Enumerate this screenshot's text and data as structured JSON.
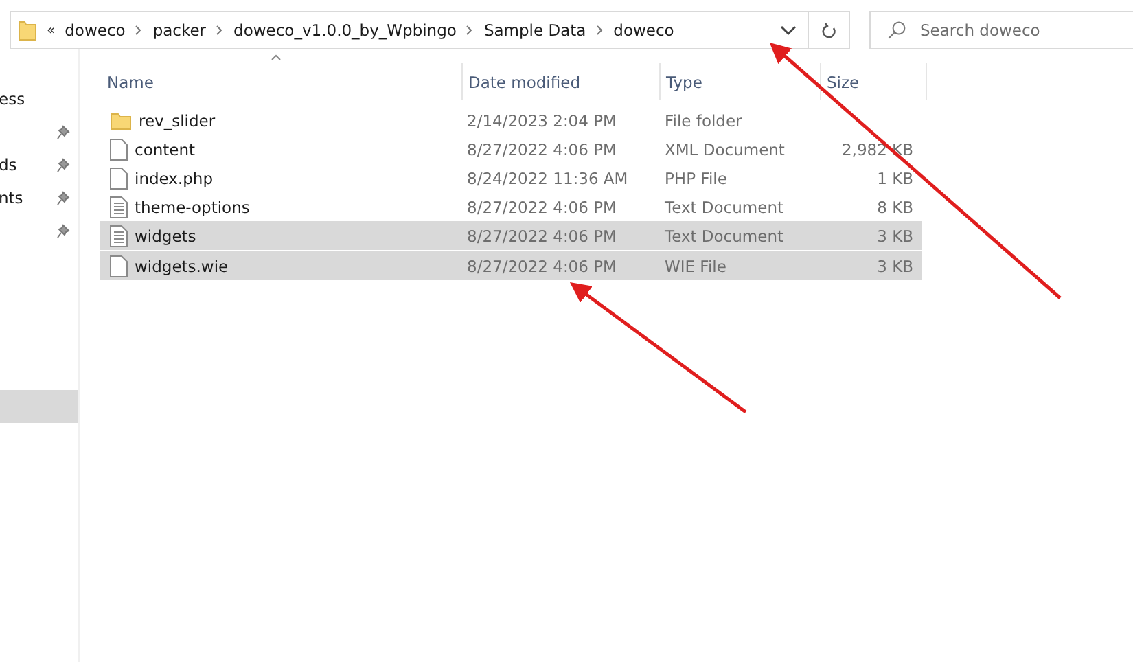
{
  "address_bar": {
    "overflow": "«",
    "crumbs": [
      "doweco",
      "packer",
      "doweco_v1.0.0_by_Wpbingo",
      "Sample Data",
      "doweco"
    ]
  },
  "search": {
    "placeholder": "Search doweco"
  },
  "sidebar": {
    "items": [
      {
        "label": "ess",
        "pinned": false,
        "selected": false
      },
      {
        "pinned": true,
        "selected": false
      },
      {
        "label": "ds",
        "pinned": true,
        "selected": false
      },
      {
        "label": "nts",
        "pinned": true,
        "selected": false
      },
      {
        "pinned": true,
        "selected": false
      },
      {
        "pinned": false,
        "selected": true
      }
    ]
  },
  "table": {
    "columns": [
      "Name",
      "Date modified",
      "Type",
      "Size"
    ],
    "rows": [
      {
        "kind": "folder",
        "name": "rev_slider",
        "date": "2/14/2023 2:04 PM",
        "type": "File folder",
        "selected": false
      },
      {
        "kind": "file",
        "name": "content",
        "date": "8/27/2022 4:06 PM",
        "type": "XML Document",
        "size": "2,982 KB",
        "selected": false
      },
      {
        "kind": "file",
        "name": "index.php",
        "date": "8/24/2022 11:36 AM",
        "type": "PHP File",
        "size": "1 KB",
        "selected": false
      },
      {
        "kind": "text",
        "name": "theme-options",
        "date": "8/27/2022 4:06 PM",
        "type": "Text Document",
        "size": "8 KB",
        "selected": false
      },
      {
        "kind": "text",
        "name": "widgets",
        "date": "8/27/2022 4:06 PM",
        "type": "Text Document",
        "size": "3 KB",
        "selected": true
      },
      {
        "kind": "file",
        "name": "widgets.wie",
        "date": "8/27/2022 4:06 PM",
        "type": "WIE File",
        "size": "3 KB",
        "selected": true
      }
    ]
  }
}
